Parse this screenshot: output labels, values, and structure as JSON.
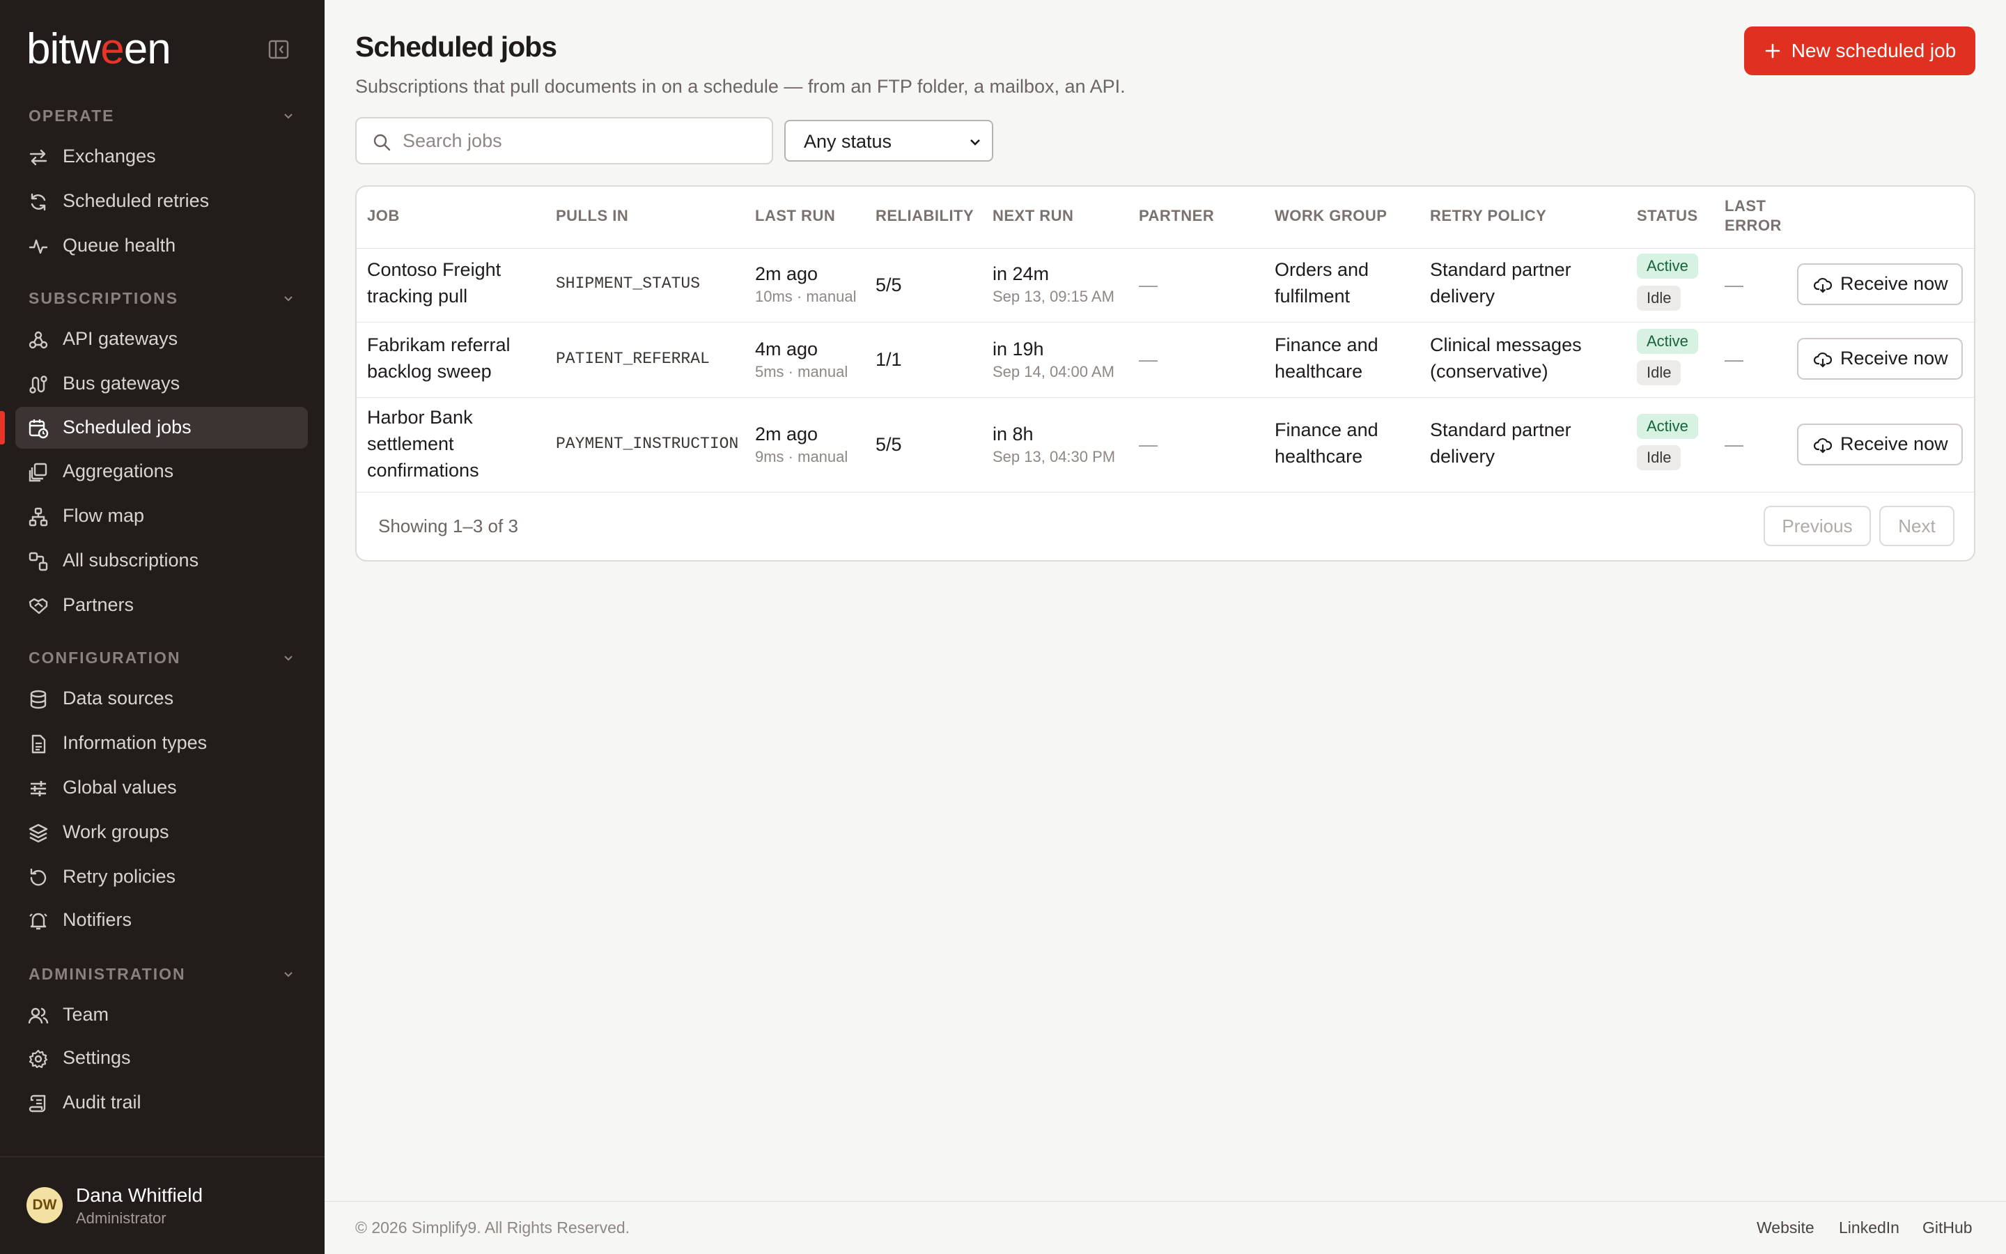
{
  "brand": {
    "logo_text": "bitween",
    "accent": "#e0301f",
    "sidebar_bg": "#221c1b",
    "collapse_icon": "sidebar-collapse-icon"
  },
  "sidebar": {
    "sections": [
      {
        "title": "OPERATE",
        "items": [
          {
            "label": "Exchanges",
            "icon": "arrows-exchange-icon"
          },
          {
            "label": "Scheduled retries",
            "icon": "refresh-icon"
          },
          {
            "label": "Queue health",
            "icon": "pulse-icon"
          }
        ]
      },
      {
        "title": "SUBSCRIPTIONS",
        "items": [
          {
            "label": "API gateways",
            "icon": "webhook-icon"
          },
          {
            "label": "Bus gateways",
            "icon": "bus-route-icon"
          },
          {
            "label": "Scheduled jobs",
            "icon": "calendar-clock-icon",
            "active": true
          },
          {
            "label": "Aggregations",
            "icon": "layers-stack-icon"
          },
          {
            "label": "Flow map",
            "icon": "flow-map-icon"
          },
          {
            "label": "All subscriptions",
            "icon": "subscriptions-icon"
          },
          {
            "label": "Partners",
            "icon": "handshake-icon"
          }
        ]
      },
      {
        "title": "CONFIGURATION",
        "items": [
          {
            "label": "Data sources",
            "icon": "database-icon"
          },
          {
            "label": "Information types",
            "icon": "document-icon"
          },
          {
            "label": "Global values",
            "icon": "sliders-icon"
          },
          {
            "label": "Work groups",
            "icon": "layers-icon"
          },
          {
            "label": "Retry policies",
            "icon": "rotate-ccw-icon"
          },
          {
            "label": "Notifiers",
            "icon": "bell-icon"
          }
        ]
      },
      {
        "title": "ADMINISTRATION",
        "items": [
          {
            "label": "Team",
            "icon": "users-icon"
          },
          {
            "label": "Settings",
            "icon": "gear-icon"
          },
          {
            "label": "Audit trail",
            "icon": "scroll-icon"
          }
        ]
      }
    ],
    "user": {
      "initials": "DW",
      "name": "Dana Whitfield",
      "role": "Administrator"
    }
  },
  "header": {
    "title": "Scheduled jobs",
    "subtitle": "Subscriptions that pull documents in on a schedule — from an FTP folder, a mailbox, an API.",
    "new_button_label": "New scheduled job"
  },
  "filters": {
    "search_placeholder": "Search jobs",
    "search_value": "",
    "status_selected": "Any status"
  },
  "table": {
    "columns": [
      "JOB",
      "PULLS IN",
      "LAST RUN",
      "RELIABILITY",
      "NEXT RUN",
      "PARTNER",
      "WORK GROUP",
      "RETRY POLICY",
      "STATUS",
      "LAST ERROR"
    ],
    "rows": [
      {
        "job": [
          "Contoso Freight",
          "tracking pull"
        ],
        "pulls_in": "SHIPMENT_STATUS",
        "last_run": "2m ago",
        "last_run_detail": "10ms · manual",
        "reliability": "5/5",
        "next_run": "in 24m",
        "next_run_detail": "Sep 13, 09:15 AM",
        "partner": "—",
        "work_group": [
          "Orders and",
          "fulfilment"
        ],
        "retry_policy": [
          "Standard partner",
          "delivery"
        ],
        "status": [
          "Active",
          "Idle"
        ],
        "last_error": "—",
        "action": "Receive now"
      },
      {
        "job": [
          "Fabrikam referral",
          "backlog sweep"
        ],
        "pulls_in": "PATIENT_REFERRAL",
        "last_run": "4m ago",
        "last_run_detail": "5ms · manual",
        "reliability": "1/1",
        "next_run": "in 19h",
        "next_run_detail": "Sep 14, 04:00 AM",
        "partner": "—",
        "work_group": [
          "Finance and",
          "healthcare"
        ],
        "retry_policy": [
          "Clinical messages",
          "(conservative)"
        ],
        "status": [
          "Active",
          "Idle"
        ],
        "last_error": "—",
        "action": "Receive now"
      },
      {
        "job": [
          "Harbor Bank",
          "settlement",
          "confirmations"
        ],
        "pulls_in": "PAYMENT_INSTRUCTION",
        "last_run": "2m ago",
        "last_run_detail": "9ms · manual",
        "reliability": "5/5",
        "next_run": "in 8h",
        "next_run_detail": "Sep 13, 04:30 PM",
        "partner": "—",
        "work_group": [
          "Finance and",
          "healthcare"
        ],
        "retry_policy": [
          "Standard partner",
          "delivery"
        ],
        "status": [
          "Active",
          "Idle"
        ],
        "last_error": "—",
        "action": "Receive now"
      }
    ],
    "showing": "Showing 1–3 of 3",
    "prev_label": "Previous",
    "next_label": "Next"
  },
  "footer": {
    "copyright": "© 2026 Simplify9. All Rights Reserved.",
    "links": [
      "Website",
      "LinkedIn",
      "GitHub"
    ]
  }
}
